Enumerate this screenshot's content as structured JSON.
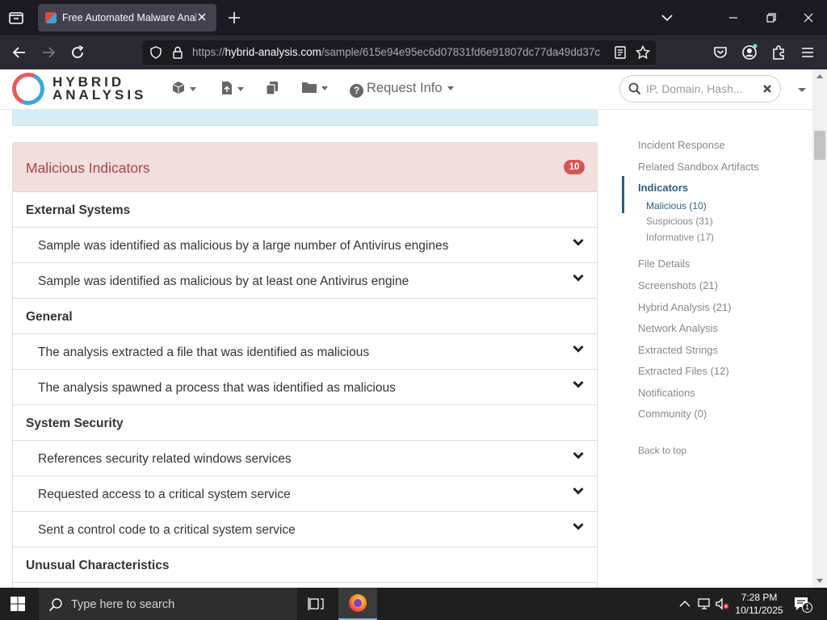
{
  "browser": {
    "tab_title": "Free Automated Malware Analysis Service",
    "url_prefix": "https://",
    "url_domain": "hybrid-analysis.com",
    "url_path": "/sample/615e94e95ec6d07831fd6e91807dc77da49dd37c"
  },
  "site": {
    "logo_line1": "HYBRID",
    "logo_line2": "ANALYSIS",
    "request_info": "Request Info",
    "search_placeholder": "IP, Domain, Hash..."
  },
  "panel": {
    "title": "Malicious Indicators",
    "count": "10",
    "sections": [
      {
        "category": "External Systems",
        "items": [
          "Sample was identified as malicious by a large number of Antivirus engines",
          "Sample was identified as malicious by at least one Antivirus engine"
        ]
      },
      {
        "category": "General",
        "items": [
          "The analysis extracted a file that was identified as malicious",
          "The analysis spawned a process that was identified as malicious"
        ]
      },
      {
        "category": "System Security",
        "items": [
          "References security related windows services",
          "Requested access to a critical system service",
          "Sent a control code to a critical system service"
        ]
      },
      {
        "category": "Unusual Characteristics",
        "items": []
      }
    ]
  },
  "sidebar": {
    "items": [
      "Incident Response",
      "Related Sandbox Artifacts",
      "Indicators",
      "Malicious (10)",
      "Suspicious (31)",
      "Informative (17)",
      "File Details",
      "Screenshots (21)",
      "Hybrid Analysis (21)",
      "Network Analysis",
      "Extracted Strings",
      "Extracted Files (12)",
      "Notifications",
      "Community (0)",
      "Back to top"
    ]
  },
  "taskbar": {
    "search_placeholder": "Type here to search",
    "time": "7:28 PM",
    "date": "10/11/2025",
    "notification_count": "1"
  }
}
